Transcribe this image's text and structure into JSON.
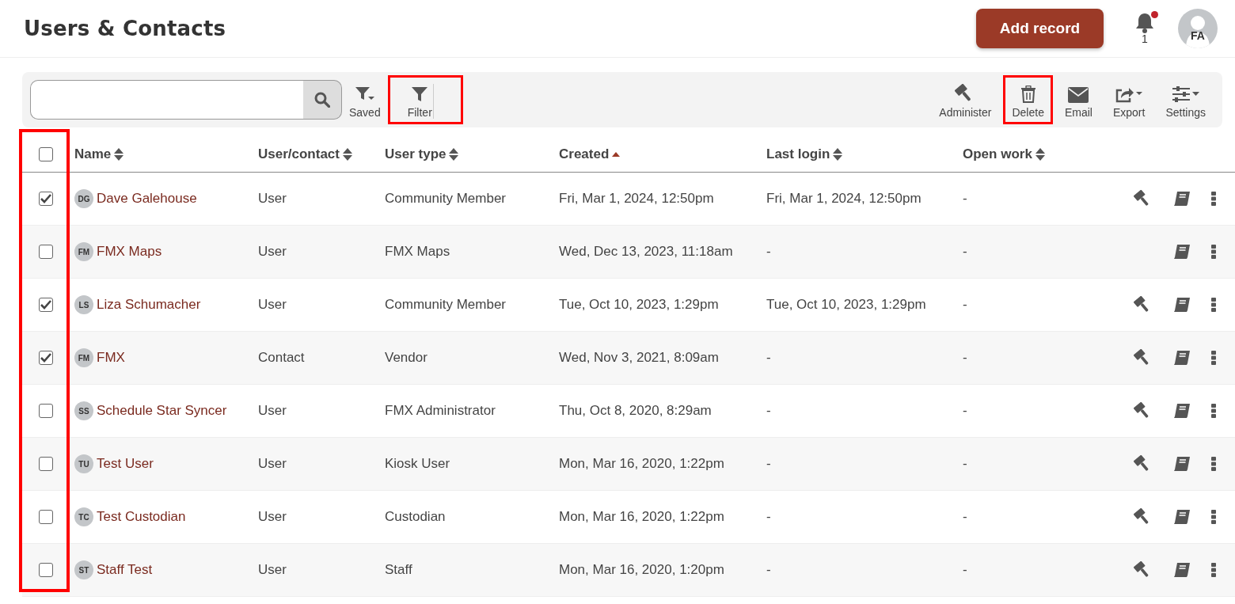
{
  "page": {
    "title": "Users & Contacts"
  },
  "header": {
    "add_button": "Add record",
    "notifications": {
      "count": "1",
      "unread": true
    },
    "avatar": "FA"
  },
  "toolbar": {
    "left_actions": [
      {
        "kind": "saved",
        "label": "Saved",
        "highlighted": false
      },
      {
        "kind": "filter",
        "label": "Filter",
        "highlighted": true
      }
    ],
    "right_actions": [
      {
        "kind": "administer",
        "label": "Administer",
        "highlighted": false
      },
      {
        "kind": "delete",
        "label": "Delete",
        "highlighted": true
      },
      {
        "kind": "email",
        "label": "Email",
        "highlighted": false
      },
      {
        "kind": "export",
        "label": "Export",
        "highlighted": false
      },
      {
        "kind": "settings",
        "label": "Settings",
        "highlighted": false
      }
    ]
  },
  "table": {
    "select_all_checked": false,
    "selection_highlighted": true,
    "columns": [
      {
        "label": "Name",
        "sorted_ascending": false
      },
      {
        "label": "User/contact",
        "sorted_ascending": false
      },
      {
        "label": "User type",
        "sorted_ascending": false
      },
      {
        "label": "Created",
        "sorted_ascending": true
      },
      {
        "label": "Last login",
        "sorted_ascending": false
      },
      {
        "label": "Open work",
        "sorted_ascending": false
      }
    ],
    "rows": [
      {
        "checked": true,
        "initials": "DG",
        "name": "Dave Galehouse",
        "user_contact": "User",
        "user_type": "Community Member",
        "created": "Fri, Mar 1, 2024, 12:50pm",
        "last_login": "Fri, Mar 1, 2024, 12:50pm",
        "open_work": "-",
        "administer": true
      },
      {
        "checked": false,
        "initials": "FM",
        "name": "FMX Maps",
        "user_contact": "User",
        "user_type": "FMX Maps",
        "created": "Wed, Dec 13, 2023, 11:18am",
        "last_login": "-",
        "open_work": "-",
        "administer": false
      },
      {
        "checked": true,
        "initials": "LS",
        "name": "Liza Schumacher",
        "user_contact": "User",
        "user_type": "Community Member",
        "created": "Tue, Oct 10, 2023, 1:29pm",
        "last_login": "Tue, Oct 10, 2023, 1:29pm",
        "open_work": "-",
        "administer": true
      },
      {
        "checked": true,
        "initials": "FM",
        "name": "FMX",
        "user_contact": "Contact",
        "user_type": "Vendor",
        "created": "Wed, Nov 3, 2021, 8:09am",
        "last_login": "-",
        "open_work": "-",
        "administer": true
      },
      {
        "checked": false,
        "initials": "SS",
        "name": "Schedule Star Syncer",
        "user_contact": "User",
        "user_type": "FMX Administrator",
        "created": "Thu, Oct 8, 2020, 8:29am",
        "last_login": "-",
        "open_work": "-",
        "administer": true
      },
      {
        "checked": false,
        "initials": "TU",
        "name": "Test User",
        "user_contact": "User",
        "user_type": "Kiosk User",
        "created": "Mon, Mar 16, 2020, 1:22pm",
        "last_login": "-",
        "open_work": "-",
        "administer": true
      },
      {
        "checked": false,
        "initials": "TC",
        "name": "Test Custodian",
        "user_contact": "User",
        "user_type": "Custodian",
        "created": "Mon, Mar 16, 2020, 1:22pm",
        "last_login": "-",
        "open_work": "-",
        "administer": true
      },
      {
        "checked": false,
        "initials": "ST",
        "name": "Staff Test",
        "user_contact": "User",
        "user_type": "Staff",
        "created": "Mon, Mar 16, 2020, 1:20pm",
        "last_login": "-",
        "open_work": "-",
        "administer": true
      }
    ]
  }
}
